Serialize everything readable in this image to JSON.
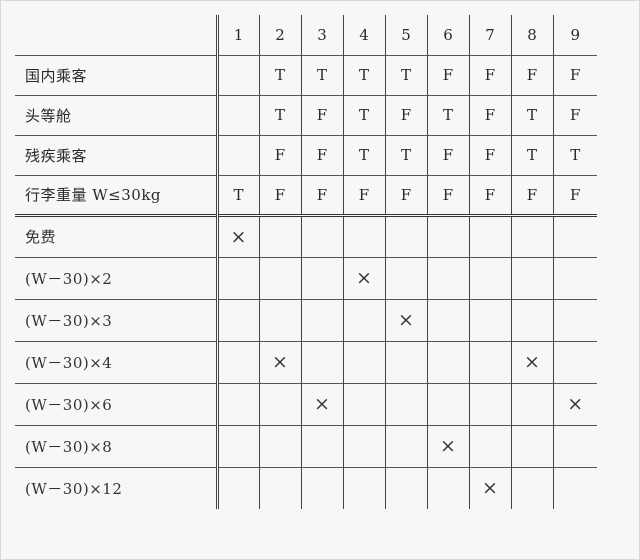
{
  "columns": [
    "1",
    "2",
    "3",
    "4",
    "5",
    "6",
    "7",
    "8",
    "9"
  ],
  "conditions": [
    {
      "label": "国内乘客",
      "values": [
        "",
        "T",
        "T",
        "T",
        "T",
        "F",
        "F",
        "F",
        "F"
      ]
    },
    {
      "label": "头等舱",
      "values": [
        "",
        "T",
        "F",
        "T",
        "F",
        "T",
        "F",
        "T",
        "F"
      ]
    },
    {
      "label": "残疾乘客",
      "values": [
        "",
        "F",
        "F",
        "T",
        "T",
        "F",
        "F",
        "T",
        "T"
      ]
    },
    {
      "label": "行李重量 W≤30kg",
      "values": [
        "T",
        "F",
        "F",
        "F",
        "F",
        "F",
        "F",
        "F",
        "F"
      ]
    }
  ],
  "actions": [
    {
      "label": "免费",
      "marks": [
        "×",
        "",
        "",
        "",
        "",
        "",
        "",
        "",
        ""
      ]
    },
    {
      "label": "(W－30)×2",
      "marks": [
        "",
        "",
        "",
        "×",
        "",
        "",
        "",
        "",
        ""
      ]
    },
    {
      "label": "(W－30)×3",
      "marks": [
        "",
        "",
        "",
        "",
        "×",
        "",
        "",
        "",
        ""
      ]
    },
    {
      "label": "(W－30)×4",
      "marks": [
        "",
        "×",
        "",
        "",
        "",
        "",
        "",
        "×",
        ""
      ]
    },
    {
      "label": "(W－30)×6",
      "marks": [
        "",
        "",
        "×",
        "",
        "",
        "",
        "",
        "",
        "×"
      ]
    },
    {
      "label": "(W－30)×8",
      "marks": [
        "",
        "",
        "",
        "",
        "",
        "×",
        "",
        "",
        ""
      ]
    },
    {
      "label": "(W－30)×12",
      "marks": [
        "",
        "",
        "",
        "",
        "",
        "",
        "×",
        "",
        ""
      ]
    }
  ]
}
